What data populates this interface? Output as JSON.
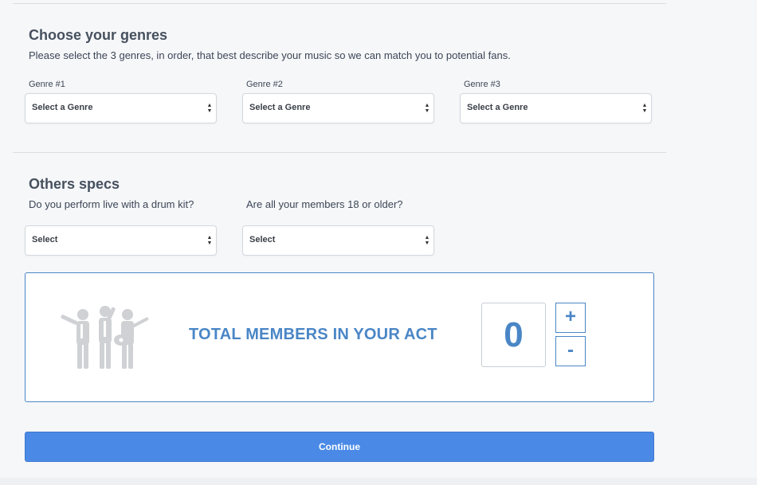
{
  "genres_section": {
    "title": "Choose your genres",
    "description": "Please select the 3 genres, in order, that best describe your music so we can match you to potential fans.",
    "fields": [
      {
        "label": "Genre #1",
        "value": "Select a Genre"
      },
      {
        "label": "Genre #2",
        "value": "Select a Genre"
      },
      {
        "label": "Genre #3",
        "value": "Select a Genre"
      }
    ]
  },
  "specs_section": {
    "title": "Others specs",
    "questions": [
      {
        "label": "Do you perform live with a drum kit?",
        "value": "Select"
      },
      {
        "label": "Are all your members 18 or older?",
        "value": "Select"
      }
    ]
  },
  "members": {
    "title": "TOTAL MEMBERS IN YOUR ACT",
    "count": "0",
    "increment_label": "+",
    "decrement_label": "-",
    "icon": "band-members-icon"
  },
  "actions": {
    "continue_label": "Continue"
  },
  "colors": {
    "accent": "#4a86c6",
    "button": "#4a8ae6",
    "background": "#f6f7f9"
  }
}
